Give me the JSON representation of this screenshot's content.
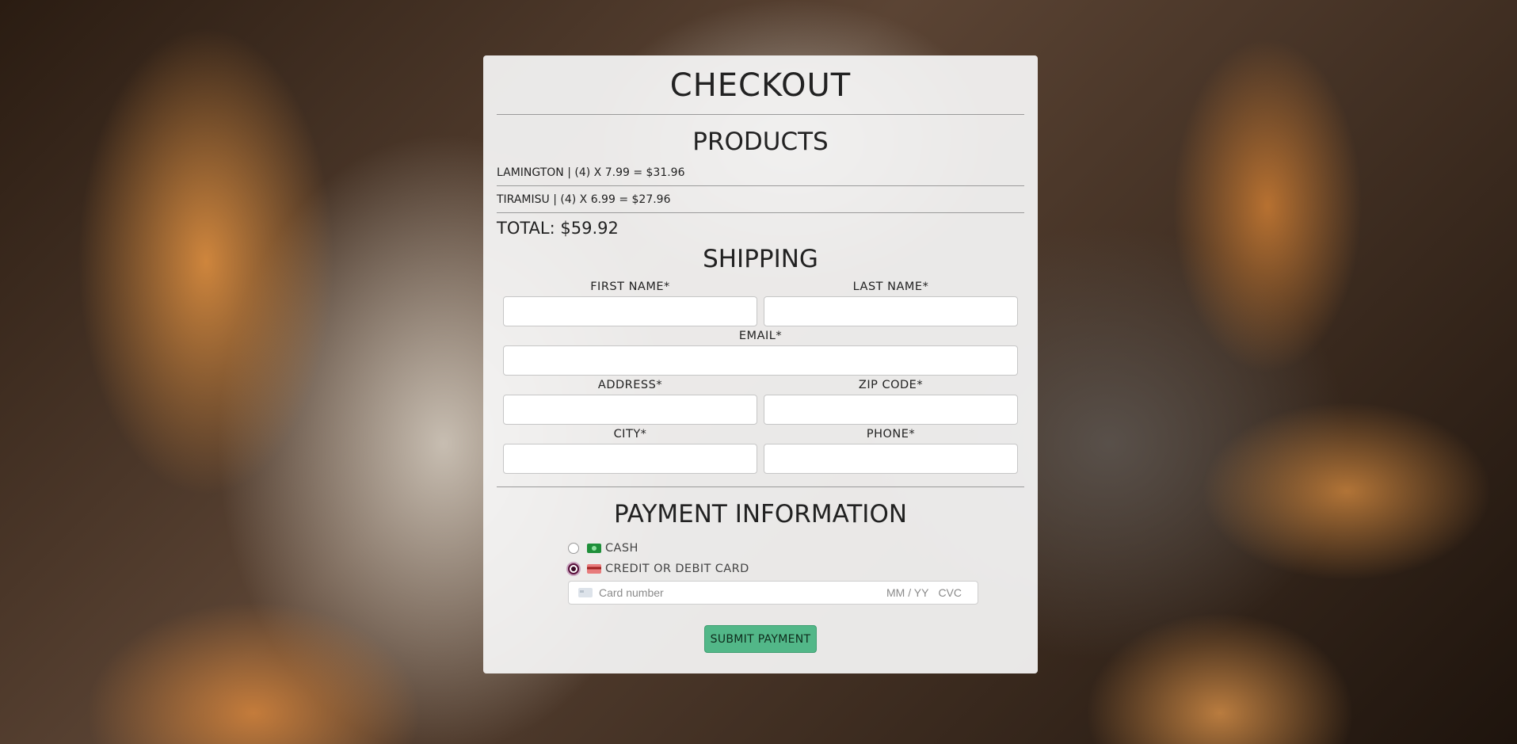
{
  "checkout": {
    "title": "CHECKOUT"
  },
  "products": {
    "heading": "PRODUCTS",
    "items": [
      {
        "text": "LAMINGTON | (4) X 7.99 = $31.96"
      },
      {
        "text": "TIRAMISU | (4) X 6.99 = $27.96"
      }
    ],
    "total": "TOTAL: $59.92"
  },
  "shipping": {
    "heading": "SHIPPING",
    "first_name_label": "FIRST NAME*",
    "last_name_label": "LAST NAME*",
    "email_label": "EMAIL*",
    "address_label": "ADDRESS*",
    "zip_label": "ZIP CODE*",
    "city_label": "CITY*",
    "phone_label": "PHONE*"
  },
  "payment": {
    "heading": "PAYMENT INFORMATION",
    "options": [
      {
        "label": "CASH",
        "selected": false,
        "icon": "cash-icon"
      },
      {
        "label": "CREDIT OR DEBIT CARD",
        "selected": true,
        "icon": "credit-card-icon"
      }
    ],
    "card_number_placeholder": "Card number",
    "expiry_placeholder": "MM / YY",
    "cvc_placeholder": "CVC",
    "submit_label": "SUBMIT PAYMENT"
  },
  "colors": {
    "submit_bg": "#52b788",
    "selected_radio": "#58103a"
  }
}
